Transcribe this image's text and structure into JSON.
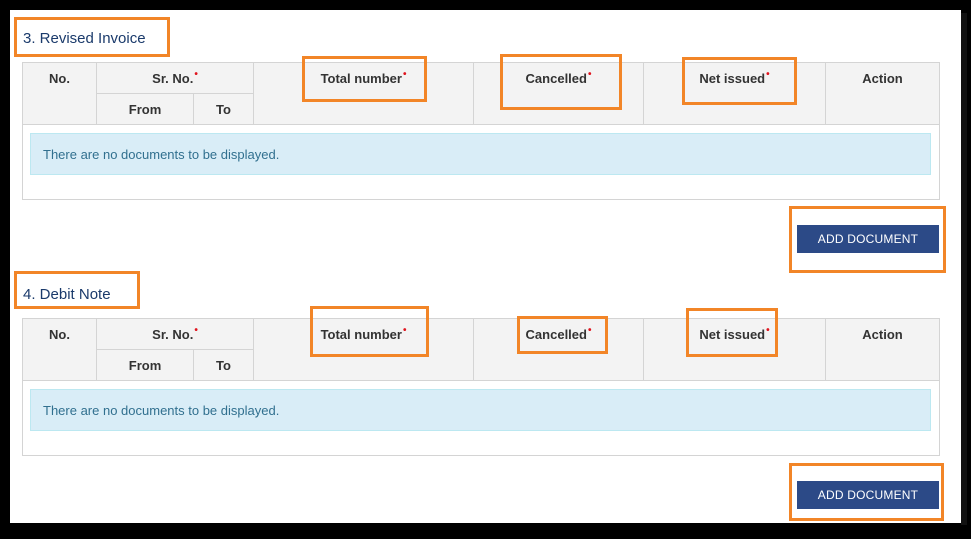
{
  "sections": [
    {
      "title": "3. Revised Invoice",
      "headers": {
        "no": "No.",
        "sr_no": "Sr. No.",
        "from": "From",
        "to": "To",
        "total_number": "Total number",
        "cancelled": "Cancelled",
        "net_issued": "Net issued",
        "action": "Action"
      },
      "empty_message": "There are no documents to be displayed.",
      "add_button": "ADD DOCUMENT"
    },
    {
      "title": "4. Debit Note",
      "headers": {
        "no": "No.",
        "sr_no": "Sr. No.",
        "from": "From",
        "to": "To",
        "total_number": "Total number",
        "cancelled": "Cancelled",
        "net_issued": "Net issued",
        "action": "Action"
      },
      "empty_message": "There are no documents to be displayed.",
      "add_button": "ADD DOCUMENT"
    }
  ],
  "required_marker": "•",
  "colors": {
    "highlight": "#f28527",
    "button": "#2c4a87",
    "title": "#1a3a6b",
    "required": "#e0141e",
    "empty_bg": "#d9edf7"
  }
}
